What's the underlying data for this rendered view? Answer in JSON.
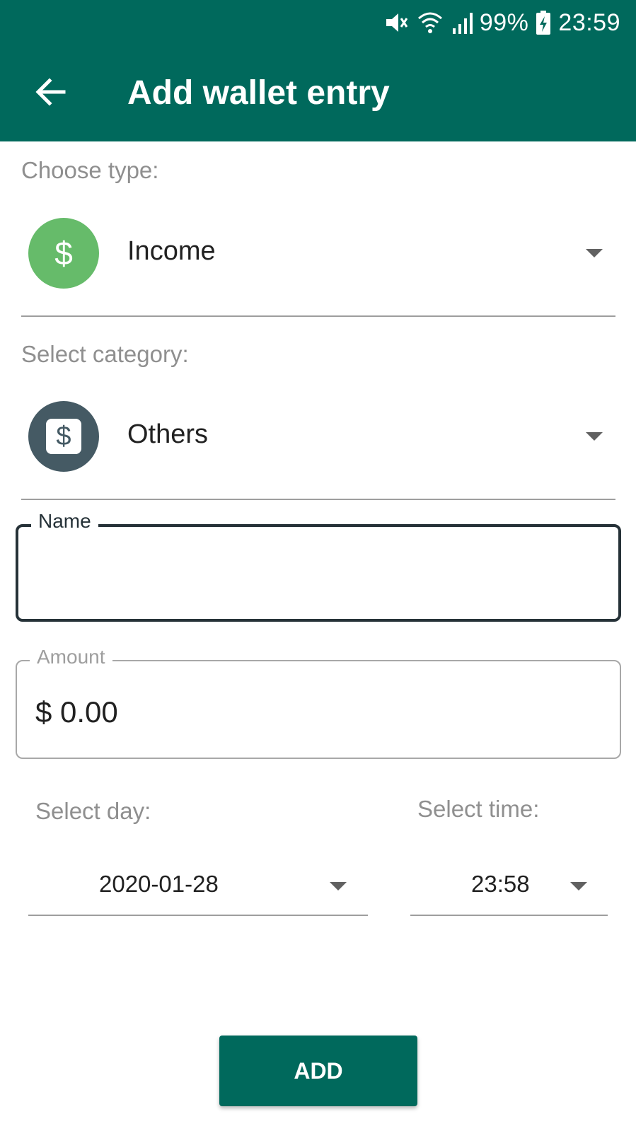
{
  "status_bar": {
    "battery": "99%",
    "time": "23:59",
    "icons": [
      "mute-icon",
      "wifi-icon",
      "signal-icon",
      "battery-charging-icon"
    ]
  },
  "header": {
    "title": "Add wallet entry",
    "back_icon": "arrow-left-icon"
  },
  "type_section": {
    "label": "Choose type:",
    "selected": "Income",
    "icon_glyph": "$",
    "icon_color": "#66bb6a"
  },
  "category_section": {
    "label": "Select category:",
    "selected": "Others",
    "icon_glyph": "$",
    "icon_color": "#455a64"
  },
  "name_field": {
    "label": "Name",
    "value": ""
  },
  "amount_field": {
    "label": "Amount",
    "value": "$ 0.00"
  },
  "day_picker": {
    "label": "Select day:",
    "value": "2020-01-28"
  },
  "time_picker": {
    "label": "Select time:",
    "value": "23:58"
  },
  "actions": {
    "add_label": "ADD"
  },
  "colors": {
    "primary": "#00695c",
    "income": "#66bb6a",
    "category": "#455a64"
  }
}
